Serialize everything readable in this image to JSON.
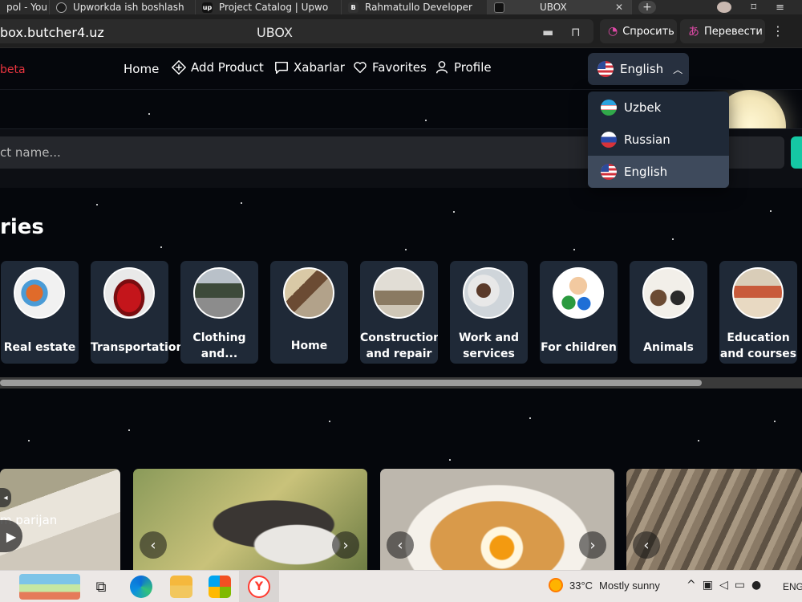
{
  "browser": {
    "tabs": [
      {
        "title": "pol - You T"
      },
      {
        "title": "Upworkda ish boshlash"
      },
      {
        "title": "Project Catalog | Upwo"
      },
      {
        "title": "Rahmatullo Developer"
      },
      {
        "title": "UBOX",
        "active": true
      }
    ],
    "close_glyph": "✕",
    "newtab_glyph": "+",
    "url": "box.butcher4.uz",
    "page_title": "UBOX",
    "ask_label": "Спросить",
    "translate_label": "Перевести"
  },
  "header": {
    "beta_label": "beta",
    "nav": [
      {
        "label": "Home",
        "icon": "none"
      },
      {
        "label": "Add Product",
        "icon": "plus-diamond-icon"
      },
      {
        "label": "Xabarlar",
        "icon": "message-icon"
      },
      {
        "label": "Favorites",
        "icon": "heart-icon"
      },
      {
        "label": "Profile",
        "icon": "user-icon"
      }
    ],
    "language": {
      "selected": "English",
      "options": [
        "Uzbek",
        "Russian",
        "English"
      ]
    }
  },
  "search": {
    "placeholder": "ct name..."
  },
  "categories": {
    "heading": "ries",
    "items": [
      {
        "label": "Real estate"
      },
      {
        "label": "Transportation"
      },
      {
        "label": "Clothing and..."
      },
      {
        "label": "Home"
      },
      {
        "label": "Construction and repair"
      },
      {
        "label": "Work and services"
      },
      {
        "label": "For children"
      },
      {
        "label": "Animals"
      },
      {
        "label": "Education and courses"
      }
    ]
  },
  "products": {
    "video_label": "m parijan",
    "prev_glyph": "‹",
    "next_glyph": "›"
  },
  "taskbar": {
    "temperature": "33°C",
    "weather": "Mostly sunny",
    "language": "ENG"
  },
  "colors": {
    "accent": "#15c8a4",
    "beta": "#e8353f",
    "card_bg": "#1f2937"
  }
}
